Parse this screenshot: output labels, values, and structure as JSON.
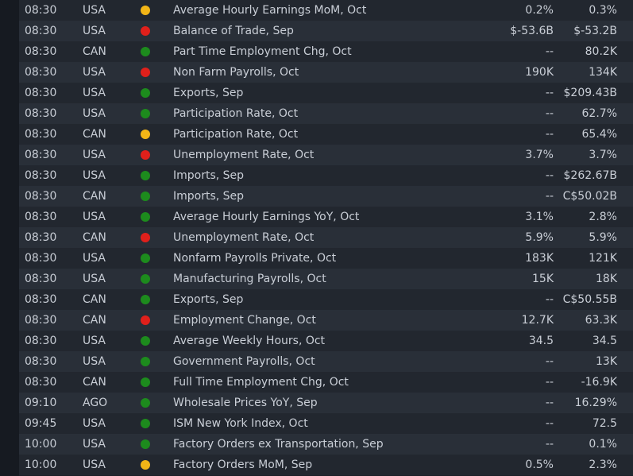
{
  "colors": {
    "high": "#e0201b",
    "medium": "#f2b517",
    "low": "#1d8b1d"
  },
  "rows": [
    {
      "time": "08:30",
      "country": "USA",
      "impact": "medium",
      "event": "Average Hourly Earnings MoM, Oct",
      "actual": "0.2%",
      "forecast": "0.3%"
    },
    {
      "time": "08:30",
      "country": "USA",
      "impact": "high",
      "event": "Balance of Trade, Sep",
      "actual": "$-53.6B",
      "forecast": "$-53.2B"
    },
    {
      "time": "08:30",
      "country": "CAN",
      "impact": "low",
      "event": "Part Time Employment Chg, Oct",
      "actual": "--",
      "forecast": "80.2K"
    },
    {
      "time": "08:30",
      "country": "USA",
      "impact": "high",
      "event": "Non Farm Payrolls, Oct",
      "actual": "190K",
      "forecast": "134K"
    },
    {
      "time": "08:30",
      "country": "USA",
      "impact": "low",
      "event": "Exports, Sep",
      "actual": "--",
      "forecast": "$209.43B"
    },
    {
      "time": "08:30",
      "country": "USA",
      "impact": "low",
      "event": "Participation Rate, Oct",
      "actual": "--",
      "forecast": "62.7%"
    },
    {
      "time": "08:30",
      "country": "CAN",
      "impact": "medium",
      "event": "Participation Rate, Oct",
      "actual": "--",
      "forecast": "65.4%"
    },
    {
      "time": "08:30",
      "country": "USA",
      "impact": "high",
      "event": "Unemployment Rate, Oct",
      "actual": "3.7%",
      "forecast": "3.7%"
    },
    {
      "time": "08:30",
      "country": "USA",
      "impact": "low",
      "event": "Imports, Sep",
      "actual": "--",
      "forecast": "$262.67B"
    },
    {
      "time": "08:30",
      "country": "CAN",
      "impact": "low",
      "event": "Imports, Sep",
      "actual": "--",
      "forecast": "C$50.02B"
    },
    {
      "time": "08:30",
      "country": "USA",
      "impact": "low",
      "event": "Average Hourly Earnings YoY, Oct",
      "actual": "3.1%",
      "forecast": "2.8%"
    },
    {
      "time": "08:30",
      "country": "CAN",
      "impact": "high",
      "event": "Unemployment Rate, Oct",
      "actual": "5.9%",
      "forecast": "5.9%"
    },
    {
      "time": "08:30",
      "country": "USA",
      "impact": "low",
      "event": "Nonfarm Payrolls Private, Oct",
      "actual": "183K",
      "forecast": "121K"
    },
    {
      "time": "08:30",
      "country": "USA",
      "impact": "low",
      "event": "Manufacturing Payrolls, Oct",
      "actual": "15K",
      "forecast": "18K"
    },
    {
      "time": "08:30",
      "country": "CAN",
      "impact": "low",
      "event": "Exports, Sep",
      "actual": "--",
      "forecast": "C$50.55B"
    },
    {
      "time": "08:30",
      "country": "CAN",
      "impact": "high",
      "event": "Employment Change, Oct",
      "actual": "12.7K",
      "forecast": "63.3K"
    },
    {
      "time": "08:30",
      "country": "USA",
      "impact": "low",
      "event": "Average Weekly Hours, Oct",
      "actual": "34.5",
      "forecast": "34.5"
    },
    {
      "time": "08:30",
      "country": "USA",
      "impact": "low",
      "event": "Government Payrolls, Oct",
      "actual": "--",
      "forecast": "13K"
    },
    {
      "time": "08:30",
      "country": "CAN",
      "impact": "low",
      "event": "Full Time Employment Chg, Oct",
      "actual": "--",
      "forecast": "-16.9K"
    },
    {
      "time": "09:10",
      "country": "AGO",
      "impact": "low",
      "event": "Wholesale Prices YoY, Sep",
      "actual": "--",
      "forecast": "16.29%"
    },
    {
      "time": "09:45",
      "country": "USA",
      "impact": "low",
      "event": "ISM New York Index, Oct",
      "actual": "--",
      "forecast": "72.5"
    },
    {
      "time": "10:00",
      "country": "USA",
      "impact": "low",
      "event": "Factory Orders ex Transportation, Sep",
      "actual": "--",
      "forecast": "0.1%"
    },
    {
      "time": "10:00",
      "country": "USA",
      "impact": "medium",
      "event": "Factory Orders MoM, Sep",
      "actual": "0.5%",
      "forecast": "2.3%"
    }
  ]
}
